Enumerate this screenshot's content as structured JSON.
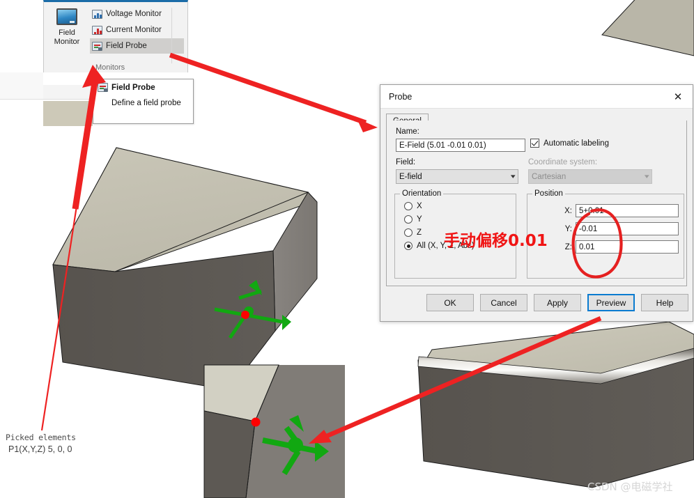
{
  "ribbon": {
    "big_button": {
      "label_line1": "Field",
      "label_line2": "Monitor",
      "icon": "monitor-icon"
    },
    "items": [
      {
        "label": "Voltage Monitor",
        "icon": "voltage-monitor-icon",
        "selected": false
      },
      {
        "label": "Current Monitor",
        "icon": "current-monitor-icon",
        "selected": false
      },
      {
        "label": "Field Probe",
        "icon": "field-probe-icon",
        "selected": true
      }
    ],
    "group_label": "Monitors"
  },
  "tooltip": {
    "title": "Field Probe",
    "description": "Define a field probe",
    "icon": "field-probe-icon"
  },
  "dialog": {
    "title": "Probe",
    "close_icon": "close-icon",
    "tabs": [
      {
        "label": "General",
        "active": true
      }
    ],
    "name_label": "Name:",
    "name_value": "E-Field (5.01 -0.01 0.01)",
    "automatic_labeling_label": "Automatic labeling",
    "automatic_labeling_checked": true,
    "field_label": "Field:",
    "field_value": "E-field",
    "coordinate_system_label": "Coordinate system:",
    "coordinate_system_value": "Cartesian",
    "coordinate_system_disabled": true,
    "orientation": {
      "caption": "Orientation",
      "options": [
        {
          "label": "X",
          "selected": false
        },
        {
          "label": "Y",
          "selected": false
        },
        {
          "label": "Z",
          "selected": false
        },
        {
          "label": "All (X, Y, Z, Abs)",
          "selected": true
        }
      ]
    },
    "position": {
      "caption": "Position",
      "fields": [
        {
          "axis": "X:",
          "value": "5+0.01"
        },
        {
          "axis": "Y:",
          "value": "-0.01"
        },
        {
          "axis": "Z:",
          "value": "0.01"
        }
      ]
    },
    "buttons": [
      {
        "label": "OK",
        "focused": false
      },
      {
        "label": "Cancel",
        "focused": false
      },
      {
        "label": "Apply",
        "focused": false
      },
      {
        "label": "Preview",
        "focused": true
      },
      {
        "label": "Help",
        "focused": false
      }
    ]
  },
  "annotations": {
    "chinese_note": "手动偏移0.01",
    "accent_color": "#ee2222",
    "circle_color": "#e52020"
  },
  "status": {
    "picked_elements_label": "Picked elements",
    "picked_point": "P1(X,Y,Z)  5, 0, 0"
  },
  "watermark": {
    "text": "CSDN @电磁学社"
  },
  "viewport": {
    "probe_marker_color": "#ff0000",
    "axis_arrow_color": "#11a811",
    "face_top_color": "#c5c2b3",
    "face_front_color": "#5d5954",
    "face_side_color": "#807c77"
  }
}
